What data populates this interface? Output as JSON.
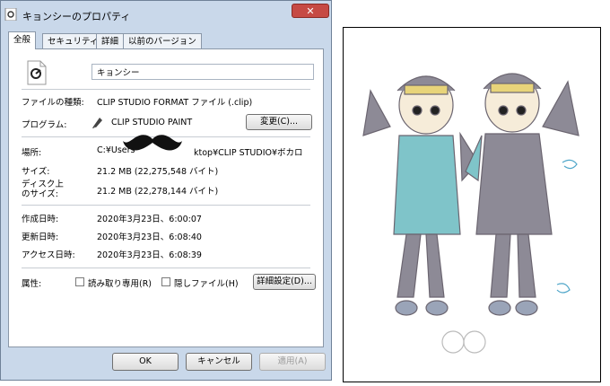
{
  "window": {
    "title": "キョンシーのプロパティ",
    "close_label": "✕"
  },
  "tabs": [
    {
      "label": "全般"
    },
    {
      "label": "セキュリティ"
    },
    {
      "label": "詳細"
    },
    {
      "label": "以前のバージョン"
    }
  ],
  "general": {
    "file_name": "キョンシー",
    "file_type_label": "ファイルの種類:",
    "file_type_value": "CLIP STUDIO FORMAT ファイル (.clip)",
    "program_label": "プログラム:",
    "program_value": "CLIP STUDIO PAINT",
    "change_button": "変更(C)...",
    "location_label": "場所:",
    "location_value_start": "C:¥Users",
    "location_value_end": "ktop¥CLIP STUDIO¥ボカロ",
    "size_label": "サイズ:",
    "size_value": "21.2 MB (22,275,548 バイト)",
    "disk_size_label_line1": "ディスク上",
    "disk_size_label_line2": "のサイズ:",
    "disk_size_value": "21.2 MB (22,278,144 バイト)",
    "created_label": "作成日時:",
    "created_value": "2020年3月23日、6:00:07",
    "modified_label": "更新日時:",
    "modified_value": "2020年3月23日、6:08:40",
    "accessed_label": "アクセス日時:",
    "accessed_value": "2020年3月23日、6:08:39",
    "attributes_label": "属性:",
    "readonly_label": "読み取り専用(R)",
    "hidden_label": "隠しファイル(H)",
    "advanced_button": "詳細設定(D)..."
  },
  "footer": {
    "ok": "OK",
    "cancel": "キャンセル",
    "apply": "適用(A)"
  },
  "icons": {
    "file": "clip-studio-file-icon",
    "program": "clip-studio-paint-icon",
    "redaction": "mustache-icon"
  },
  "colors": {
    "dialog_frame": "#c9d8ea",
    "close_button": "#c64a44",
    "art_teal": "#7fc4c9"
  }
}
